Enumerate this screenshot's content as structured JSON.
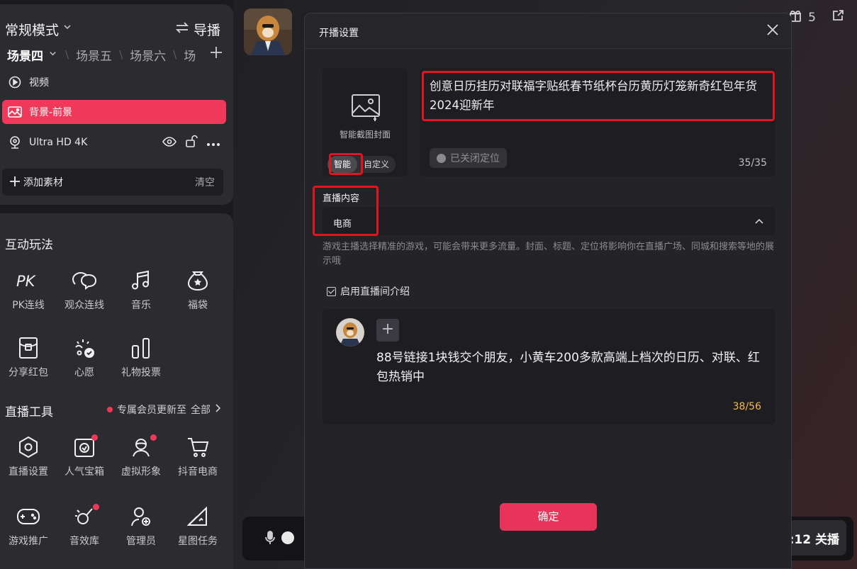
{
  "sidebar": {
    "mode_title": "常规模式",
    "director_label": "导播",
    "scenes": [
      "场景四",
      "场景五",
      "场景六",
      "场"
    ],
    "sources": {
      "video": "视频",
      "background": "背景-前景",
      "uhd": "Ultra HD 4K"
    },
    "add_material": "添加素材",
    "clear": "清空"
  },
  "interactive": {
    "title": "互动玩法",
    "items": [
      "PK连线",
      "观众连线",
      "音乐",
      "福袋",
      "分享红包",
      "心愿",
      "礼物投票"
    ]
  },
  "tools": {
    "title": "直播工具",
    "vip_text": "专属会员更新至",
    "all": "全部",
    "items": [
      "直播设置",
      "人气宝箱",
      "虚拟形象",
      "抖音电商",
      "游戏推广",
      "音效库",
      "管理员",
      "星图任务"
    ]
  },
  "topbar": {
    "gift_count": "5"
  },
  "bottombar": {
    "end_label": ":12 关播"
  },
  "modal": {
    "title": "开播设置",
    "cover_label": "智能截图封面",
    "cover_tabs": [
      "智能",
      "自定义"
    ],
    "live_title": "创意日历挂历对联福字贴纸春节纸杯台历黄历灯笼新奇红包年货2024迎新年",
    "location": "已关闭定位",
    "title_count": "35/35",
    "content_label": "直播内容",
    "content_value": "电商",
    "hint": "游戏主播选择精准的游戏，可能会带来更多流量。封面、标题、定位将影响你在直播广场、同城和搜索等地的展示哦",
    "intro_checkbox": "启用直播间介绍",
    "intro_text": "88号链接1块钱交个朋友，小黄车200多款高端上档次的日历、对联、红包热销中",
    "intro_count": "38/56",
    "confirm": "确定"
  },
  "colors": {
    "accent": "#f0395a",
    "confirm": "#e8345a",
    "highlight": "#e3141d",
    "counter_warn": "#f5b84c"
  }
}
